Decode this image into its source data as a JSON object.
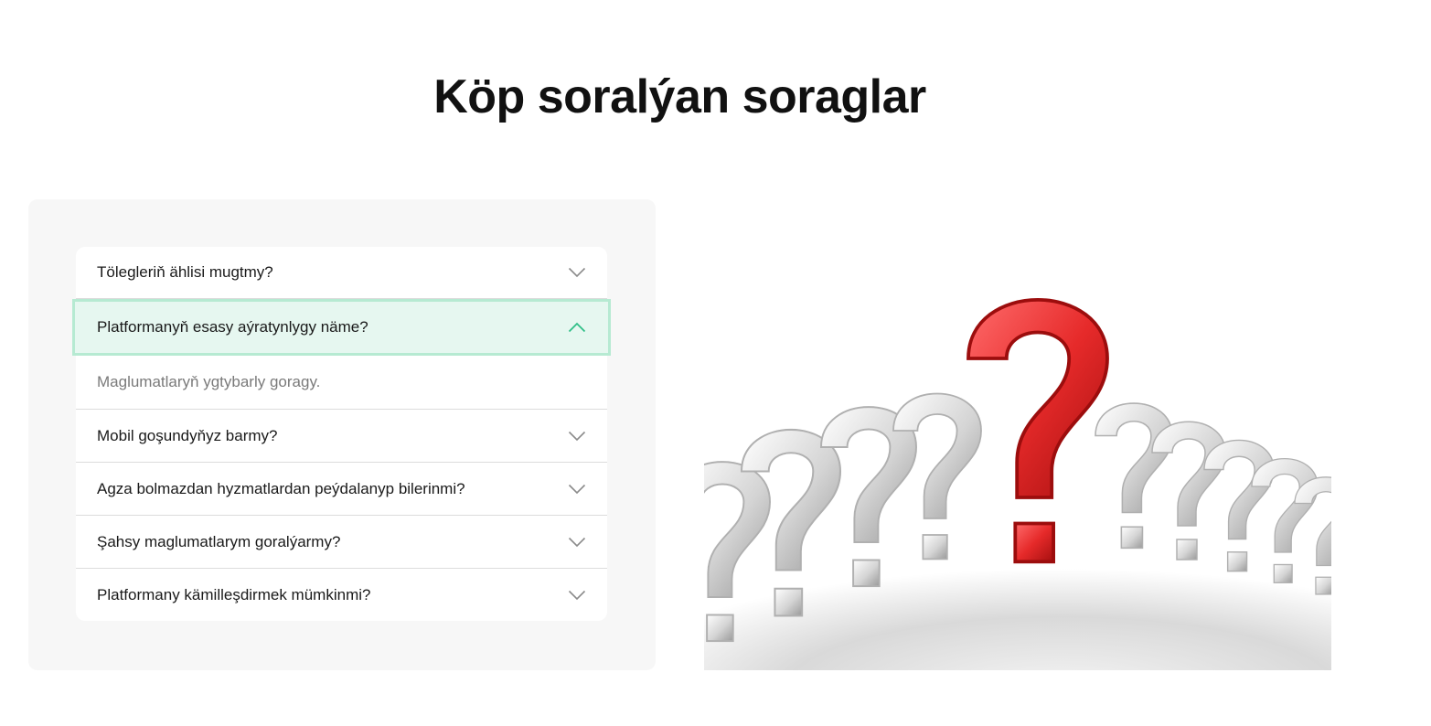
{
  "page": {
    "title": "Köp soralýan soraglar"
  },
  "faq": {
    "items": [
      {
        "question": "Tölegleriň ählisi mugtmy?",
        "open": false
      },
      {
        "question": "Platformanyň esasy aýratynlygy näme?",
        "open": true,
        "answer": "Maglumatlaryň ygtybarly goragy."
      },
      {
        "question": "Mobil goşundyňyz barmy?",
        "open": false
      },
      {
        "question": "Agza bolmazdan hyzmatlardan peýdalanyp bilerinmi?",
        "open": false
      },
      {
        "question": "Şahsy maglumatlarym goralýarmy?",
        "open": false
      },
      {
        "question": "Platformany kämilleşdirmek mümkinmi?",
        "open": false
      }
    ]
  },
  "colors": {
    "accent": "#2fbf87",
    "open_bg": "#e6f7f0",
    "open_border": "#b6ead2",
    "chevron": "#8a8a8a"
  },
  "icons": {
    "collapsed": "chevron-down-icon",
    "expanded": "chevron-up-icon",
    "illustration": "question-marks-illustration"
  }
}
